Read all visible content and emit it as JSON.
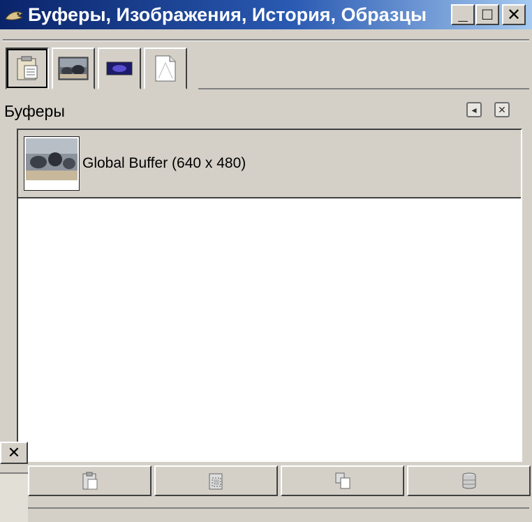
{
  "window": {
    "title": "Буферы, Изображения, История, Образцы",
    "icon": "gimp-wilber-icon",
    "buttons": {
      "minimize": "_",
      "maximize": "□",
      "close": "✕"
    }
  },
  "tabs": [
    {
      "icon": "buffers-icon",
      "active": true
    },
    {
      "icon": "images-icon",
      "active": false
    },
    {
      "icon": "undo-history-icon",
      "active": false
    },
    {
      "icon": "templates-icon",
      "active": false
    }
  ],
  "dock": {
    "title": "Буферы",
    "menu_icon": "tab-menu-icon",
    "close_icon": "close-tab-icon"
  },
  "buffers": [
    {
      "label": "Global Buffer (640 x 480)"
    }
  ],
  "left_partial_close": "✕",
  "bottom_buttons": [
    {
      "icon": "paste-icon"
    },
    {
      "icon": "paste-into-icon"
    },
    {
      "icon": "paste-as-new-icon"
    },
    {
      "icon": "delete-icon"
    }
  ]
}
